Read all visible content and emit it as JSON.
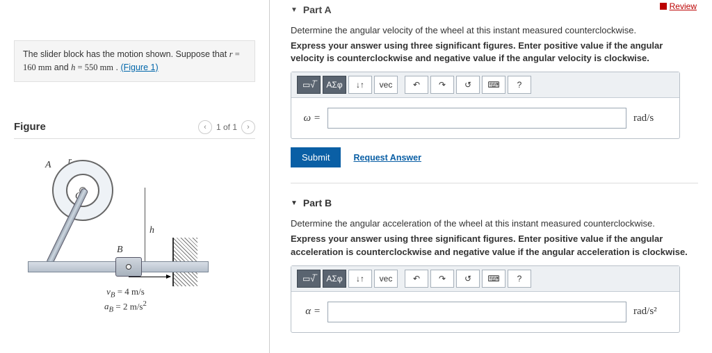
{
  "header": {
    "review": "Review"
  },
  "problem": {
    "text_pre": "The slider block has the motion shown. Suppose that ",
    "r_var": "r",
    "r_eq": " = 160 ",
    "r_unit": "mm",
    "and": " and ",
    "h_var": "h",
    "h_eq": " = 550 ",
    "h_unit": "mm",
    "period": " . ",
    "fig_link": "(Figure 1)"
  },
  "figure": {
    "title": "Figure",
    "pager": "1 of 1",
    "labels": {
      "A": "A",
      "C": "C",
      "B": "B",
      "r": "r",
      "h": "h"
    },
    "vb": "v_B = 4 m/s",
    "ab": "a_B = 2 m/s²"
  },
  "partA": {
    "title": "Part A",
    "instr": "Determine the angular velocity of the wheel at this instant measured counterclockwise.",
    "bold": "Express your answer using three significant figures. Enter positive value if the angular velocity is counterclockwise and negative value if the angular velocity is clockwise.",
    "var": "ω =",
    "unit": "rad/s",
    "submit": "Submit",
    "request": "Request Answer"
  },
  "partB": {
    "title": "Part B",
    "instr": "Determine the angular acceleration of the wheel at this instant measured counterclockwise.",
    "bold": "Express your answer using three significant figures. Enter positive value if the angular acceleration is counterclockwise and negative value if the angular acceleration is clockwise.",
    "var": "α =",
    "unit": "rad/s²"
  },
  "toolbar": {
    "templates": "▭√̅",
    "greek": "ΑΣφ",
    "subsup": "↓↑",
    "vec": "vec",
    "undo": "↶",
    "redo": "↷",
    "reset": "↺",
    "keyboard": "⌨",
    "help": "?"
  }
}
